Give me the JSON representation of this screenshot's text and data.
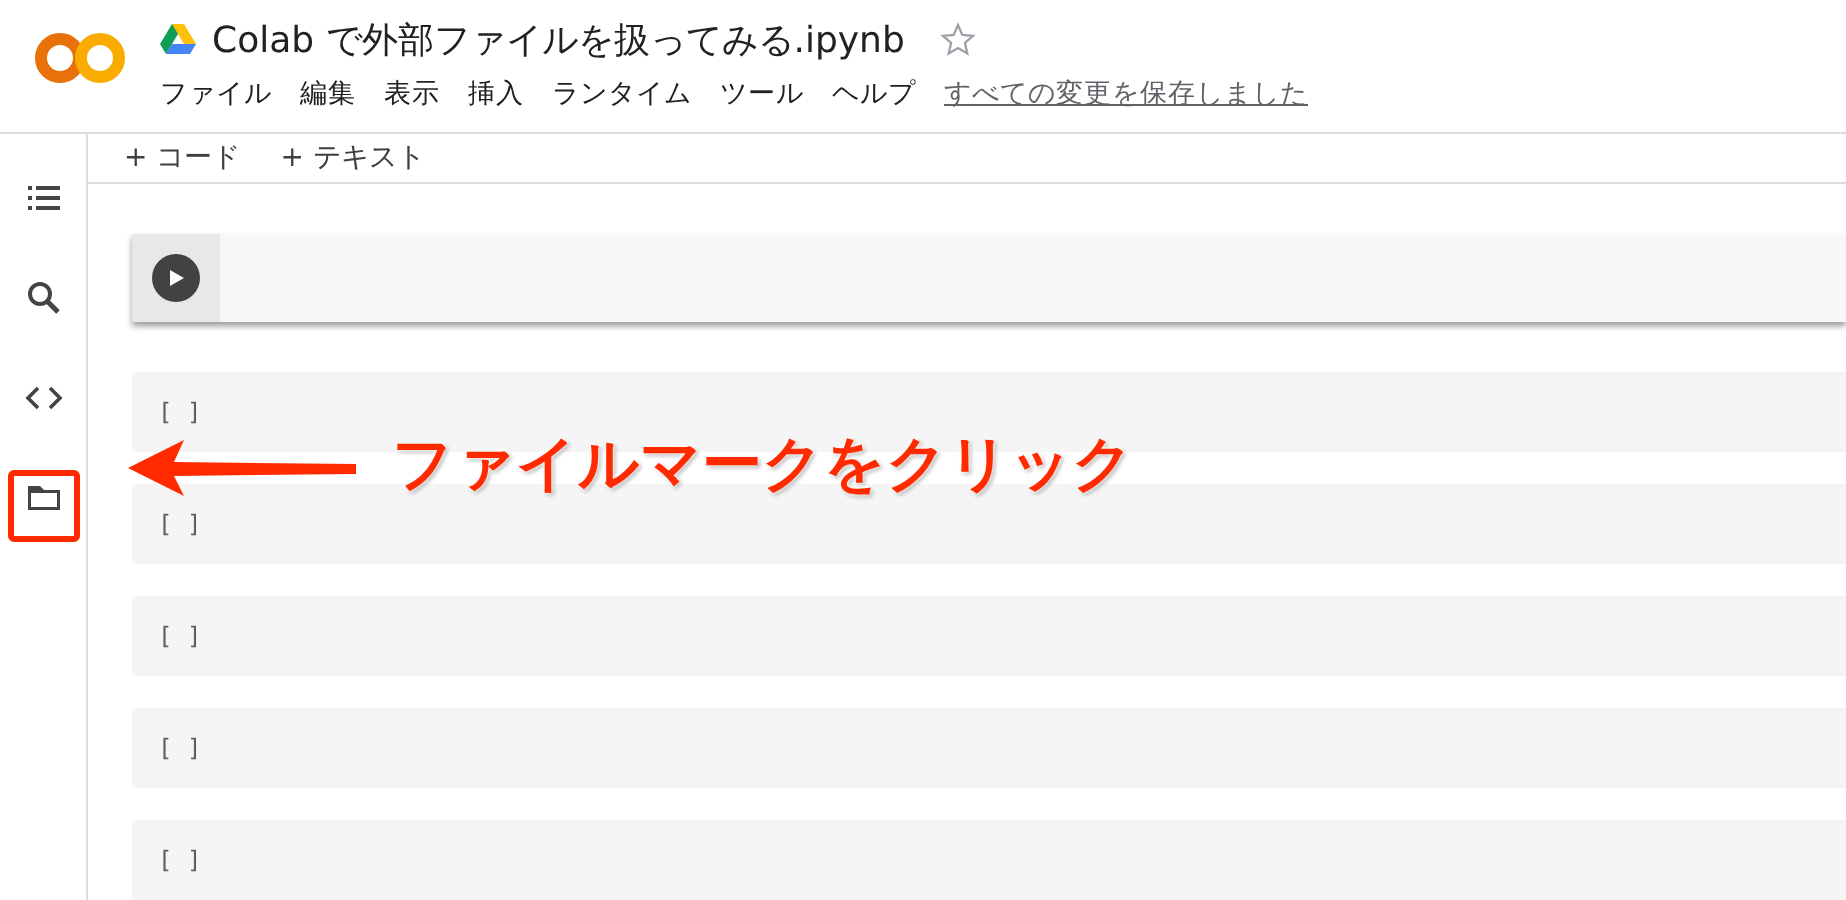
{
  "header": {
    "title": "Colab で外部ファイルを扱ってみる.ipynb",
    "starred": false,
    "menu": [
      "ファイル",
      "編集",
      "表示",
      "挿入",
      "ランタイム",
      "ツール",
      "ヘルプ"
    ],
    "save_status": "すべての変更を保存しました"
  },
  "toolbar": [
    {
      "plus": "+",
      "label": "コード"
    },
    {
      "plus": "+",
      "label": "テキスト"
    }
  ],
  "cells": [
    {
      "kind": "focused"
    },
    {
      "kind": "code",
      "prompt": "[ ]"
    },
    {
      "kind": "code",
      "prompt": "[ ]"
    },
    {
      "kind": "code",
      "prompt": "[ ]"
    },
    {
      "kind": "code",
      "prompt": "[ ]"
    },
    {
      "kind": "code",
      "prompt": "[ ]"
    }
  ],
  "annotation": {
    "text": "ファイルマークをクリック"
  }
}
